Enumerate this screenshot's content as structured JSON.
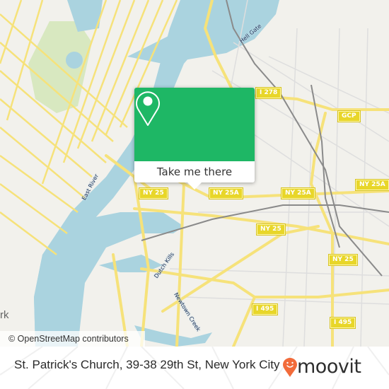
{
  "map": {
    "colors": {
      "land": "#f2f1ec",
      "water": "#aad3df",
      "park": "#d8e8c0",
      "road_major": "#f6e27a",
      "road_minor": "#ffffff",
      "rail": "#8a8a8a",
      "accent": "#1eb765",
      "moovit_orange": "#f26b3a"
    },
    "shields": [
      {
        "label": "I 278"
      },
      {
        "label": "GCP"
      },
      {
        "label": "NY 25"
      },
      {
        "label": "NY 25A"
      },
      {
        "label": "NY 25A"
      },
      {
        "label": "NY 25A"
      },
      {
        "label": "NY 25"
      },
      {
        "label": "NY 25"
      },
      {
        "label": "I 495"
      },
      {
        "label": "I 495"
      }
    ],
    "water_labels": [
      {
        "label": "Hell Gate"
      },
      {
        "label": "East River"
      },
      {
        "label": "Dutch Kills"
      },
      {
        "label": "Newtown Creek"
      }
    ],
    "place_fragment": "rk",
    "attribution": "© OpenStreetMap contributors"
  },
  "popup": {
    "icon": "location-pin-icon",
    "cta_label": "Take me there"
  },
  "footer": {
    "place_name": "St. Patrick's Church, 39-38 29th St, New York City",
    "brand": "moovit",
    "brand_icon": "moovit-smiley-pin-icon"
  }
}
